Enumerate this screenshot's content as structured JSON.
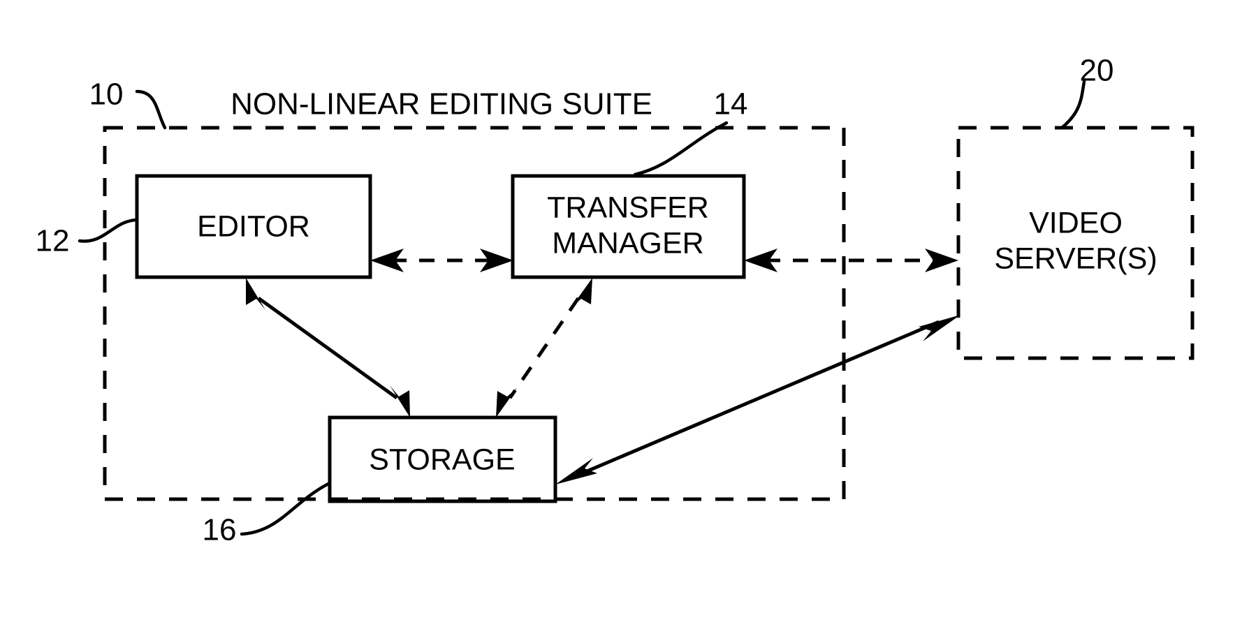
{
  "figure": {
    "type": "patent-block-diagram",
    "background_color": "#ffffff",
    "line_color": "#000000",
    "title": "NON-LINEAR EDITING SUITE"
  },
  "containers": [
    {
      "id": "suite",
      "label": "NON-LINEAR EDITING SUITE",
      "numeral": "10",
      "style": "dashed"
    },
    {
      "id": "video-server",
      "label_line1": "VIDEO",
      "label_line2": "SERVER(S)",
      "numeral": "20",
      "style": "dashed"
    }
  ],
  "blocks": [
    {
      "id": "editor",
      "label": "EDITOR",
      "numeral": "12",
      "style": "solid"
    },
    {
      "id": "transfer-manager",
      "label_line1": "TRANSFER",
      "label_line2": "MANAGER",
      "numeral": "14",
      "style": "solid"
    },
    {
      "id": "storage",
      "label": "STORAGE",
      "numeral": "16",
      "style": "solid"
    }
  ],
  "numerals": {
    "suite": "10",
    "editor": "12",
    "transfer_manager": "14",
    "storage": "16",
    "video_server": "20"
  },
  "connections": [
    {
      "id": "editor-transfer",
      "from": "editor",
      "to": "transfer-manager",
      "style": "dashed",
      "arrows": "both"
    },
    {
      "id": "transfer-videoserver",
      "from": "transfer-manager",
      "to": "video-server",
      "style": "dashed",
      "arrows": "both"
    },
    {
      "id": "editor-storage",
      "from": "editor",
      "to": "storage",
      "style": "solid",
      "arrows": "both"
    },
    {
      "id": "transfer-storage",
      "from": "transfer-manager",
      "to": "storage",
      "style": "dashed",
      "arrows": "both"
    },
    {
      "id": "storage-videoserver",
      "from": "storage",
      "to": "video-server",
      "style": "solid",
      "arrows": "both"
    }
  ]
}
